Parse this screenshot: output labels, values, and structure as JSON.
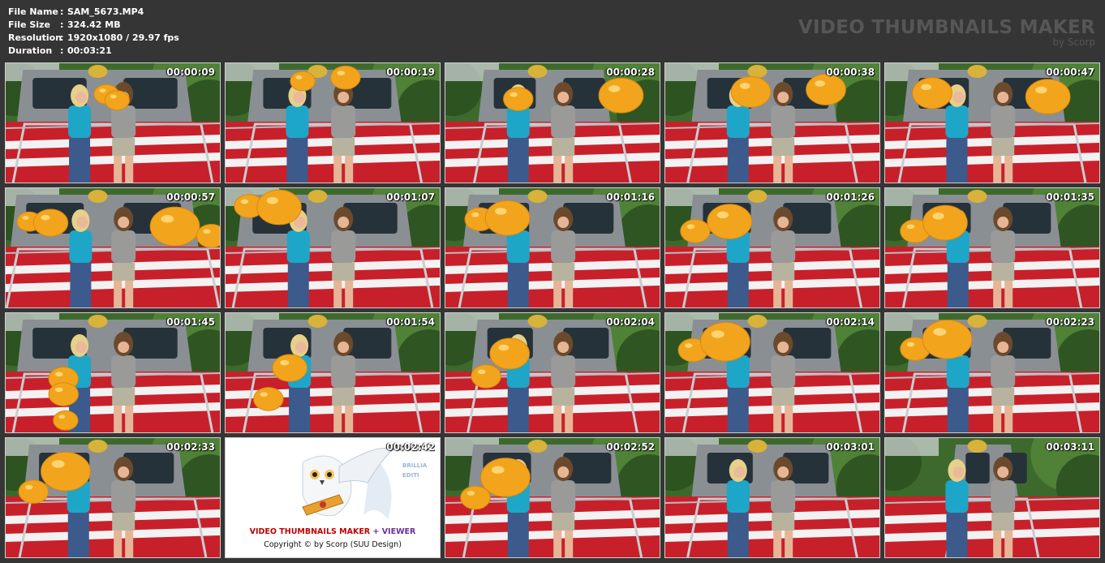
{
  "info": {
    "rows": [
      {
        "label": "File Name",
        "value": "SAM_5673.MP4"
      },
      {
        "label": "File Size",
        "value": "324.42 MB"
      },
      {
        "label": "Resolution",
        "value": "1920x1080 / 29.97 fps"
      },
      {
        "label": "Duration",
        "value": "00:03:21"
      }
    ],
    "separator": ":"
  },
  "brand": {
    "title": "VIDEO THUMBNAILS MAKER",
    "subtitle": "by Scorp"
  },
  "thumbnails": [
    {
      "time": "00:00:09"
    },
    {
      "time": "00:00:19"
    },
    {
      "time": "00:00:28"
    },
    {
      "time": "00:00:38"
    },
    {
      "time": "00:00:47"
    },
    {
      "time": "00:00:57"
    },
    {
      "time": "00:01:07"
    },
    {
      "time": "00:01:16"
    },
    {
      "time": "00:01:26"
    },
    {
      "time": "00:01:35"
    },
    {
      "time": "00:01:45"
    },
    {
      "time": "00:01:54"
    },
    {
      "time": "00:02:04"
    },
    {
      "time": "00:02:14"
    },
    {
      "time": "00:02:23"
    },
    {
      "time": "00:02:33"
    },
    {
      "time": "00:02:42"
    },
    {
      "time": "00:02:52"
    },
    {
      "time": "00:03:01"
    },
    {
      "time": "00:03:11"
    }
  ],
  "logo": {
    "title_part1": "VIDEO THUMBNAILS MAKER",
    "title_plus": " + ",
    "title_part2": "VIEWER",
    "copyright": "Copyright © by Scorp (SUU Design)",
    "side_text_1": "BRILLIA",
    "side_text_2": "EDITI"
  },
  "colors": {
    "background": "#353535",
    "train_red": "#c8202a",
    "balloon": "#f2a51c"
  }
}
